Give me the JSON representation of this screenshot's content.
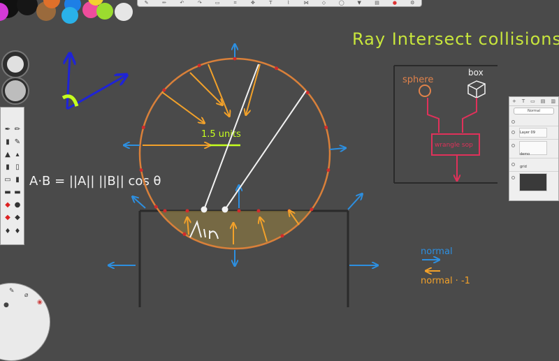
{
  "title": "Ray Intersect collisions",
  "label_units": "1.5 units",
  "formula": "A·B = ||A|| ||B|| cos θ",
  "diagram_labels": {
    "sphere": "sphere",
    "box": "box",
    "wrangle_sop": "wrangle sop",
    "vin": "Vin"
  },
  "legend": {
    "normal": "normal",
    "normal_neg": "normal · -1"
  },
  "layers_panel": {
    "mode": "Normal",
    "layers": [
      "Layer 09",
      "demo",
      "grid",
      ""
    ]
  },
  "colors": {
    "background": "#4a4a4a",
    "title_green": "#c8e63c",
    "ray_orange": "#f2a12a",
    "normal_blue": "#2d8fe0",
    "circle_orange": "#d9803a",
    "marker_red": "#d22b2b",
    "wrangle_red": "#e0315a",
    "axis_blue": "#1f24d6",
    "angle_green": "#c6ff1e",
    "chalk_white": "#f2f2f2"
  },
  "icons": {
    "top_toolbar": [
      "brush-icon",
      "pencil-icon",
      "undo-icon",
      "redo-icon",
      "select-icon",
      "crop-icon",
      "transform-icon",
      "text-icon",
      "ruler-icon",
      "symmetry-icon",
      "perspective-icon",
      "shape-icon",
      "fill-icon",
      "layers-icon",
      "color-icon",
      "settings-icon"
    ]
  }
}
